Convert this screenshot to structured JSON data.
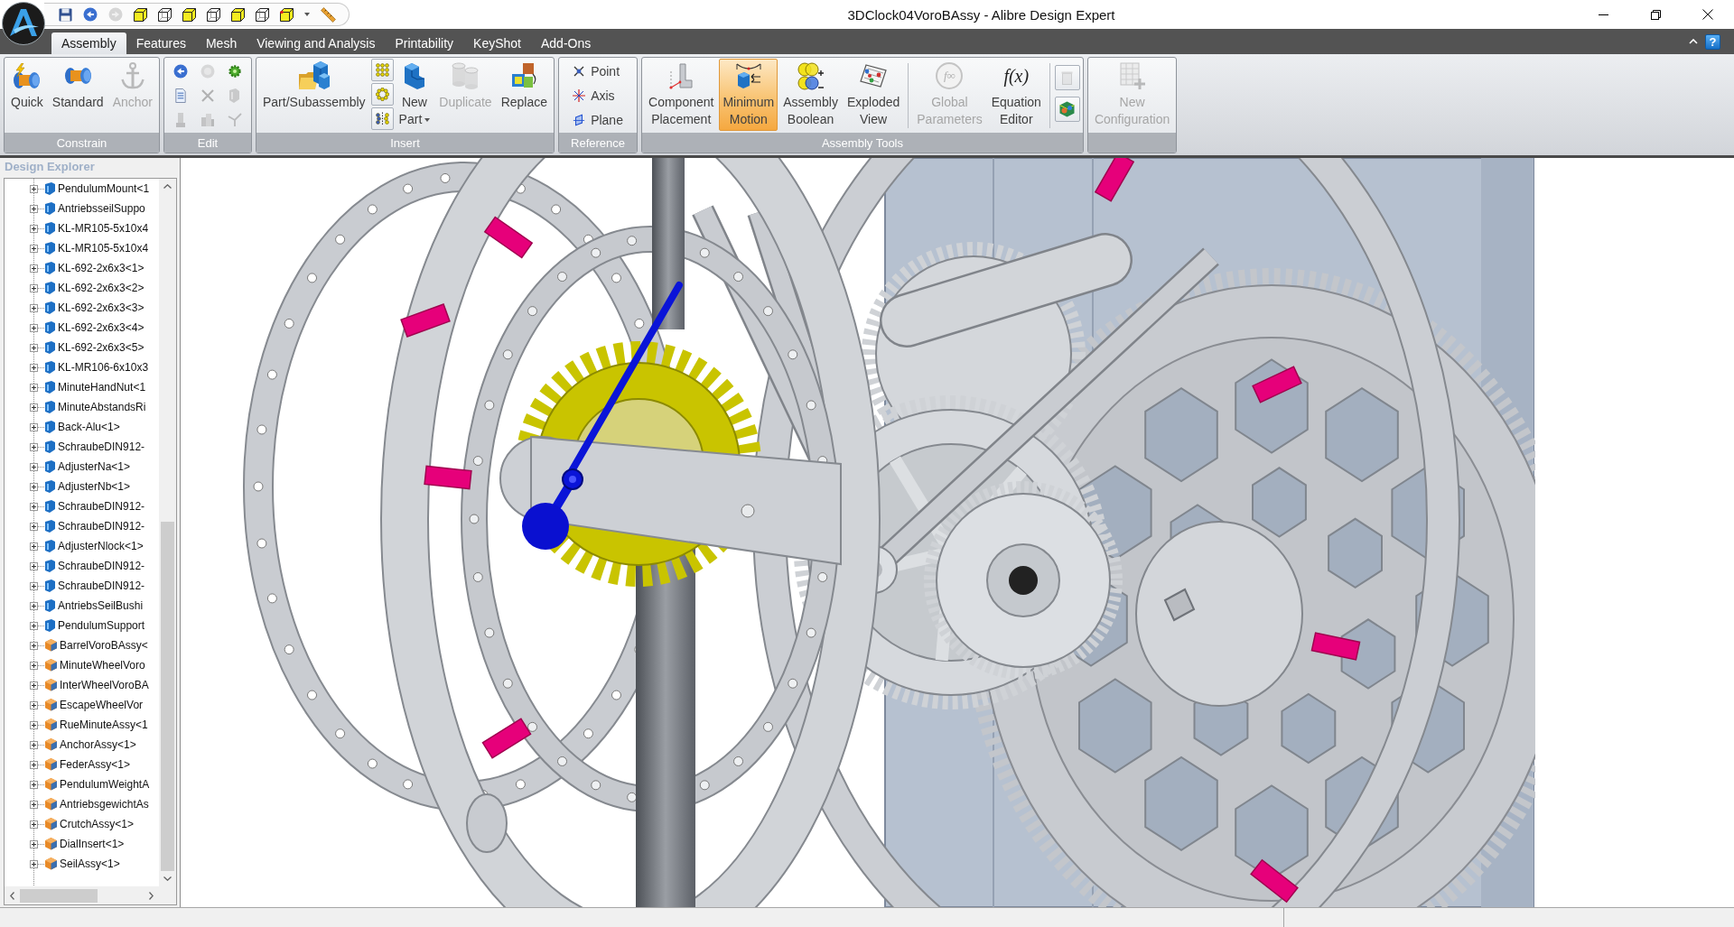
{
  "window": {
    "title": "3DClock04VoroBAssy - Alibre Design Expert"
  },
  "quick_access": [
    {
      "disabled": false
    },
    {
      "disabled": false
    },
    {
      "disabled": true
    },
    {
      "disabled": false
    },
    {
      "disabled": false
    },
    {
      "disabled": false
    },
    {
      "disabled": false
    },
    {
      "disabled": false
    },
    {
      "disabled": false
    },
    {
      "disabled": false
    },
    {
      "disabled": false
    },
    {
      "disabled": false
    }
  ],
  "tabs": [
    {
      "label": "Assembly",
      "selected": true
    },
    {
      "label": "Features",
      "selected": false
    },
    {
      "label": "Mesh",
      "selected": false
    },
    {
      "label": "Viewing and Analysis",
      "selected": false
    },
    {
      "label": "Printability",
      "selected": false
    },
    {
      "label": "KeyShot",
      "selected": false
    },
    {
      "label": "Add-Ons",
      "selected": false
    }
  ],
  "help_button": {
    "label": "?"
  },
  "ribbon": {
    "groups": [
      {
        "label": "Constrain",
        "items": [
          {
            "kind": "large",
            "label": "Quick",
            "disabled": false,
            "on": false,
            "dropdown": false
          },
          {
            "kind": "large",
            "label": "Standard",
            "disabled": false,
            "on": false,
            "dropdown": false
          },
          {
            "kind": "large",
            "label": "Anchor",
            "disabled": true,
            "on": false,
            "dropdown": false
          }
        ]
      },
      {
        "label": "Edit",
        "items": [
          {
            "kind": "grid",
            "buttons": [
              {
                "disabled": false
              },
              {
                "disabled": true
              },
              {
                "disabled": false
              },
              {
                "disabled": false
              },
              {
                "disabled": true
              },
              {
                "disabled": true
              },
              {
                "disabled": true
              },
              {
                "disabled": true
              },
              {
                "disabled": true
              }
            ]
          }
        ]
      },
      {
        "label": "Insert",
        "items": [
          {
            "kind": "large",
            "label": "Part/Subassembly",
            "disabled": false,
            "on": false,
            "dropdown": false
          },
          {
            "kind": "stack",
            "buttons": [
              {
                "disabled": false
              },
              {
                "disabled": false
              },
              {
                "disabled": false
              }
            ]
          },
          {
            "kind": "large",
            "label": "New\nPart",
            "disabled": false,
            "on": false,
            "dropdown": true
          },
          {
            "kind": "large",
            "label": "Duplicate",
            "disabled": true,
            "on": false,
            "dropdown": false
          },
          {
            "kind": "large",
            "label": "Replace",
            "disabled": false,
            "on": false,
            "dropdown": false
          }
        ]
      },
      {
        "label": "Reference",
        "items": [
          {
            "kind": "list",
            "buttons": [
              {
                "label": "Point",
                "disabled": false
              },
              {
                "label": "Axis",
                "disabled": false
              },
              {
                "label": "Plane",
                "disabled": false
              }
            ]
          }
        ]
      },
      {
        "label": "Assembly Tools",
        "items": [
          {
            "kind": "large",
            "label": "Component\nPlacement",
            "disabled": false,
            "on": false,
            "dropdown": false
          },
          {
            "kind": "large",
            "label": "Minimum\nMotion",
            "disabled": false,
            "on": true,
            "dropdown": false
          },
          {
            "kind": "large",
            "label": "Assembly\nBoolean",
            "disabled": false,
            "on": false,
            "dropdown": false
          },
          {
            "kind": "large",
            "label": "Exploded\nView",
            "disabled": false,
            "on": false,
            "dropdown": false
          },
          {
            "kind": "separator"
          },
          {
            "kind": "large",
            "label": "Global\nParameters",
            "disabled": true,
            "on": false,
            "dropdown": false,
            "icon_text": "f∞"
          },
          {
            "kind": "large",
            "label": "Equation\nEditor",
            "disabled": false,
            "on": false,
            "dropdown": false,
            "icon_text": "f(x)"
          },
          {
            "kind": "separator"
          },
          {
            "kind": "stack",
            "buttons": [
              {
                "disabled": true
              },
              {
                "disabled": false
              }
            ]
          }
        ]
      },
      {
        "items": [
          {
            "kind": "large",
            "label": "New\nConfiguration",
            "disabled": true,
            "on": false,
            "dropdown": false
          }
        ]
      }
    ]
  },
  "design_explorer": {
    "title": "Design Explorer",
    "items": [
      {
        "label": "PendulumMount<1",
        "kind": "part",
        "expanded": false
      },
      {
        "label": "AntriebsseilSuppo",
        "kind": "part",
        "expanded": false
      },
      {
        "label": "KL-MR105-5x10x4",
        "kind": "part",
        "expanded": false
      },
      {
        "label": "KL-MR105-5x10x4",
        "kind": "part",
        "expanded": false
      },
      {
        "label": "KL-692-2x6x3<1>",
        "kind": "part",
        "expanded": false
      },
      {
        "label": "KL-692-2x6x3<2>",
        "kind": "part",
        "expanded": false
      },
      {
        "label": "KL-692-2x6x3<3>",
        "kind": "part",
        "expanded": false
      },
      {
        "label": "KL-692-2x6x3<4>",
        "kind": "part",
        "expanded": false
      },
      {
        "label": "KL-692-2x6x3<5>",
        "kind": "part",
        "expanded": false
      },
      {
        "label": "KL-MR106-6x10x3",
        "kind": "part",
        "expanded": false
      },
      {
        "label": "MinuteHandNut<1",
        "kind": "part",
        "expanded": false
      },
      {
        "label": "MinuteAbstandsRi",
        "kind": "part",
        "expanded": false
      },
      {
        "label": "Back-Alu<1>",
        "kind": "part",
        "expanded": false
      },
      {
        "label": "SchraubeDIN912-",
        "kind": "part",
        "expanded": false
      },
      {
        "label": "AdjusterNa<1>",
        "kind": "part",
        "expanded": false
      },
      {
        "label": "AdjusterNb<1>",
        "kind": "part",
        "expanded": false
      },
      {
        "label": "SchraubeDIN912-",
        "kind": "part",
        "expanded": false
      },
      {
        "label": "SchraubeDIN912-",
        "kind": "part",
        "expanded": false
      },
      {
        "label": "AdjusterNlock<1>",
        "kind": "part",
        "expanded": false
      },
      {
        "label": "SchraubeDIN912-",
        "kind": "part",
        "expanded": false
      },
      {
        "label": "SchraubeDIN912-",
        "kind": "part",
        "expanded": false
      },
      {
        "label": "AntriebsSeilBushi",
        "kind": "part",
        "expanded": false
      },
      {
        "label": "PendulumSupport",
        "kind": "part",
        "expanded": false
      },
      {
        "label": "BarrelVoroBAssy<",
        "kind": "assembly",
        "expanded": false
      },
      {
        "label": "MinuteWheelVoro",
        "kind": "assembly",
        "expanded": false
      },
      {
        "label": "InterWheelVoroBA",
        "kind": "assembly",
        "expanded": false
      },
      {
        "label": "EscapeWheelVor",
        "kind": "assembly",
        "expanded": false
      },
      {
        "label": "RueMinuteAssy<1",
        "kind": "assembly",
        "expanded": false
      },
      {
        "label": "AnchorAssy<1>",
        "kind": "assembly",
        "expanded": false
      },
      {
        "label": "FederAssy<1>",
        "kind": "assembly",
        "expanded": false
      },
      {
        "label": "PendulumWeightA",
        "kind": "assembly",
        "expanded": false
      },
      {
        "label": "AntriebsgewichtAs",
        "kind": "assembly",
        "expanded": false
      },
      {
        "label": "CrutchAssy<1>",
        "kind": "assembly",
        "expanded": false
      },
      {
        "label": "DialInsert<1>",
        "kind": "assembly",
        "expanded": false
      },
      {
        "label": "SeilAssy<1>",
        "kind": "assembly",
        "expanded": false
      }
    ]
  }
}
